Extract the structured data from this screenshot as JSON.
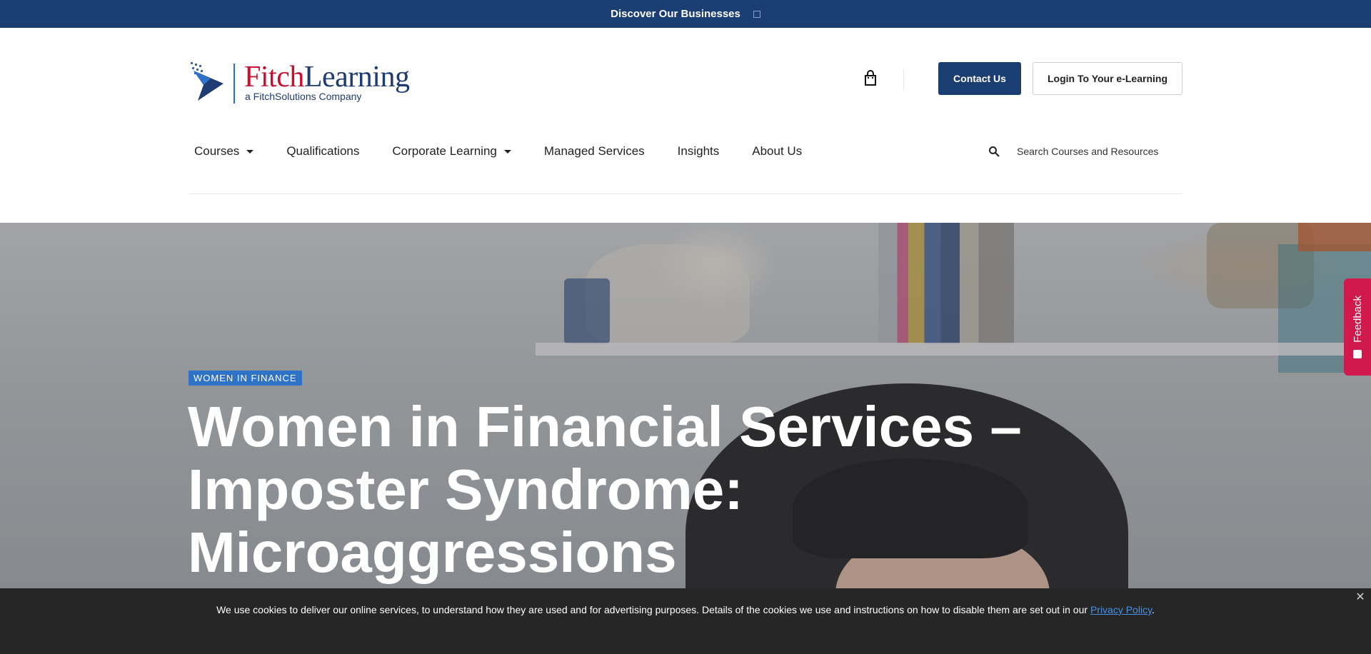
{
  "topbar": {
    "label": "Discover Our Businesses"
  },
  "logo": {
    "name_part1": "Fitch",
    "name_part2": "Learning",
    "tagline": "a FitchSolutions Company"
  },
  "header": {
    "contact_label": "Contact Us",
    "login_label": "Login To Your e-Learning",
    "cart_icon": "shopping-bag-icon"
  },
  "nav": {
    "items": [
      {
        "label": "Courses",
        "has_dropdown": true
      },
      {
        "label": "Qualifications",
        "has_dropdown": false
      },
      {
        "label": "Corporate Learning",
        "has_dropdown": true
      },
      {
        "label": "Managed Services",
        "has_dropdown": false
      },
      {
        "label": "Insights",
        "has_dropdown": false
      },
      {
        "label": "About Us",
        "has_dropdown": false
      }
    ],
    "search_placeholder": "Search Courses and Resources"
  },
  "hero": {
    "tag": "WOMEN IN FINANCE",
    "title": "Women in Financial Services – Imposter Syndrome: Microaggressions"
  },
  "feedback": {
    "label": "Feedback"
  },
  "cookie": {
    "text": "We use cookies to deliver our online services, to understand how they are used and for advertising purposes. Details of the cookies we use and instructions on how to disable them are set out in our ",
    "link": "Privacy Policy",
    "end": "."
  },
  "colors": {
    "brand_navy": "#1a3e72",
    "brand_red": "#c8102e",
    "tag_blue": "#2f73c9",
    "feedback_red": "#d01a4e"
  }
}
